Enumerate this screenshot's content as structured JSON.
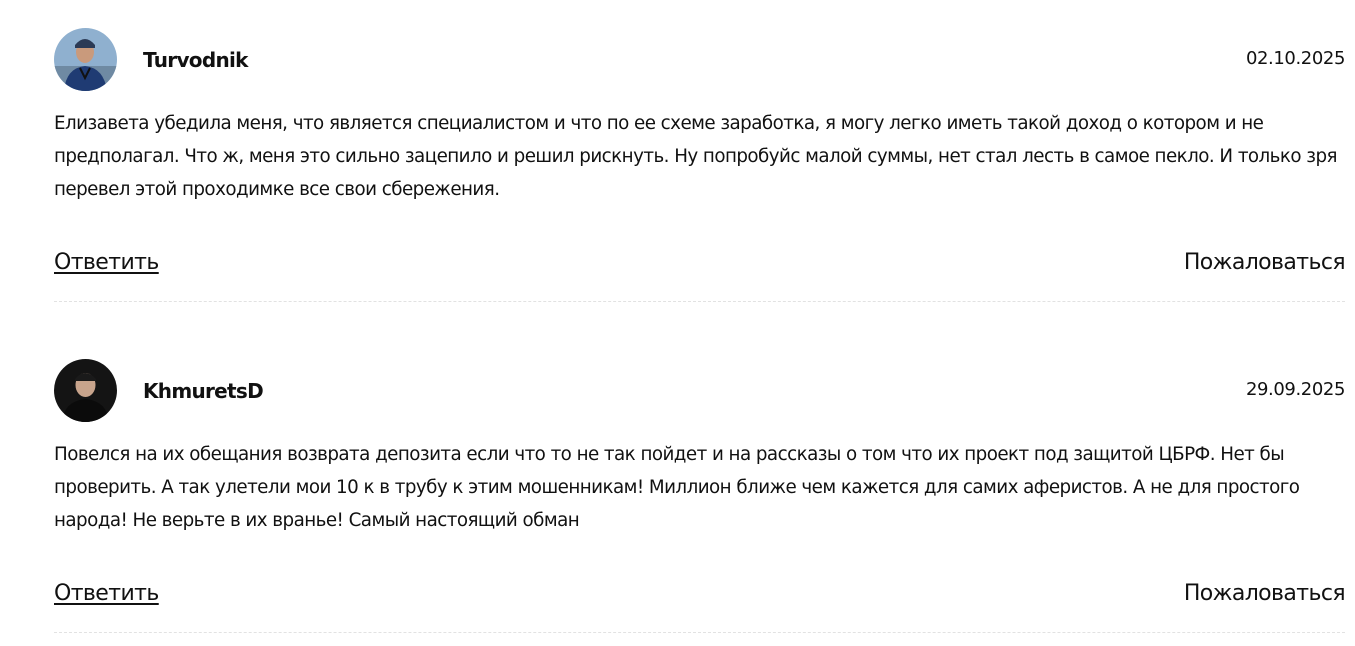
{
  "comments": [
    {
      "author": "Turvodnik",
      "date": "02.10.2025",
      "text": "Елизавета убедила меня, что является специалистом и что по ее схеме заработка, я могу легко иметь такой доход о котором и не предполагал. Что ж, меня это сильно зацепило и решил рискнуть. Ну попробуйс малой суммы, нет стал лесть в самое пекло. И только зря перевел этой проходимке все свои сбережения.",
      "reply_label": "Ответить",
      "report_label": "Пожаловаться"
    },
    {
      "author": "KhmuretsD",
      "date": "29.09.2025",
      "text": "Повелся на их обещания возврата депозита если что то не так пойдет и на рассказы о том что их проект под защитой ЦБРФ. Нет бы проверить. А так улетели мои 10 к в трубу к этим мошенникам! Миллион ближе чем кажется для самих аферистов. А не для простого народа! Не верьте в их вранье! Самый настоящий обман",
      "reply_label": "Ответить",
      "report_label": "Пожаловаться"
    }
  ],
  "colors": {
    "text": "#111111",
    "divider": "#e2e2e2",
    "background": "#ffffff"
  }
}
